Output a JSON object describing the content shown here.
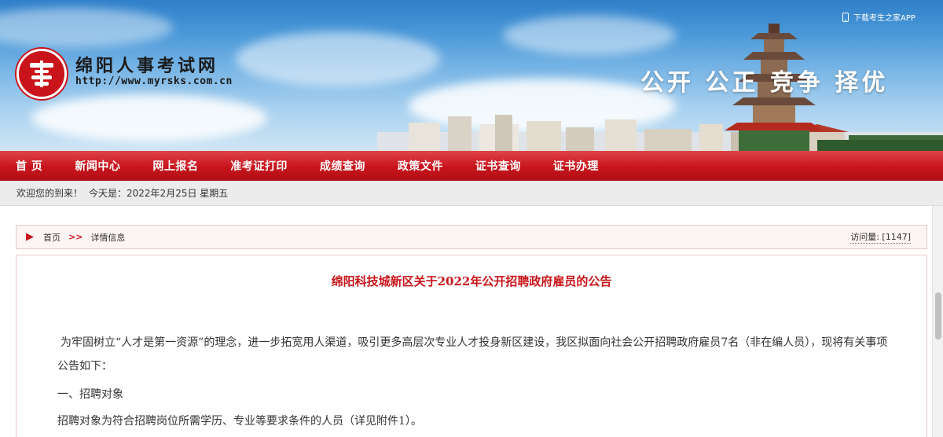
{
  "header": {
    "site_title": "绵阳人事考试网",
    "site_url": "http://www.myrsks.com.cn",
    "slogan": "公开 公正 竞争 择优",
    "app_link_label": "下载考生之家APP",
    "logo_icon": "seal-logo-icon"
  },
  "nav": {
    "items": [
      {
        "label": "首 页"
      },
      {
        "label": "新闻中心"
      },
      {
        "label": "网上报名"
      },
      {
        "label": "准考证打印"
      },
      {
        "label": "成绩查询"
      },
      {
        "label": "政策文件"
      },
      {
        "label": "证书查询"
      },
      {
        "label": "证书办理"
      }
    ],
    "active_index": 1
  },
  "welcome": {
    "greeting": "欢迎您的到来！",
    "date_text": "今天是：2022年2月25日 星期五"
  },
  "breadcrumb": {
    "home": "首页",
    "separator": ">>",
    "current": "详情信息",
    "visits_label": "访问量: [1147]"
  },
  "article": {
    "title": "绵阳科技城新区关于2022年公开招聘政府雇员的公告",
    "paragraph1": "为牢固树立“人才是第一资源”的理念，进一步拓宽用人渠道，吸引更多高层次专业人才投身新区建设，我区拟面向社会公开招聘政府雇员7名（非在编人员），现将有关事项公告如下：",
    "heading1": "一、招聘对象",
    "paragraph2": "招聘对象为符合招聘岗位所需学历、专业等要求条件的人员（详见附件1）。"
  },
  "colors": {
    "brand_red": "#c8141a",
    "title_red": "#c8141a",
    "sky_blue": "#4a98d8"
  }
}
